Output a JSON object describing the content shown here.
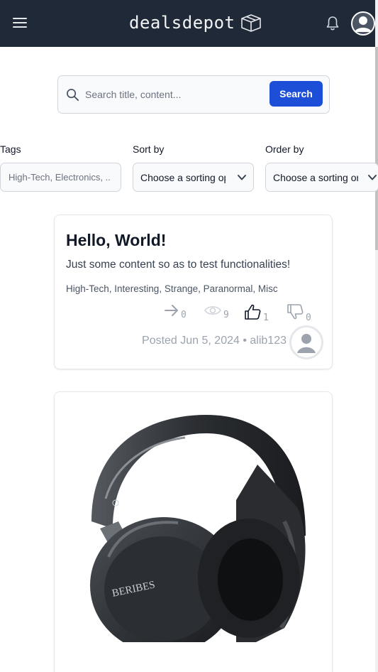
{
  "nav": {
    "brand": "dealsdepot",
    "menu_icon": "hamburger-menu-icon",
    "brand_icon": "box-3d-icon",
    "bell_icon": "bell-icon",
    "avatar_icon": "user-avatar-icon",
    "background": "#1f2937"
  },
  "search": {
    "placeholder": "Search title, content...",
    "button_label": "Search",
    "button_color": "#1d4ed8"
  },
  "filters": {
    "tags": {
      "label": "Tags",
      "value": "High-Tech, Electronics, .."
    },
    "sort_by": {
      "label": "Sort by",
      "value": "Choose a sorting op"
    },
    "order_by": {
      "label": "Order by",
      "value": "Choose a sorting or"
    }
  },
  "posts": [
    {
      "title": "Hello, World!",
      "content": "Just some content so as to test functionalities!",
      "tags": "High-Tech, Interesting, Strange, Paranormal, Misc",
      "stats": {
        "shares": "0",
        "views": "9",
        "likes": "1",
        "dislikes": "0"
      },
      "meta": "Posted Jun 5, 2024 • alib123"
    },
    {
      "image_subject": "black over-ear headphones",
      "brand_on_image": "BERIBES"
    }
  ]
}
